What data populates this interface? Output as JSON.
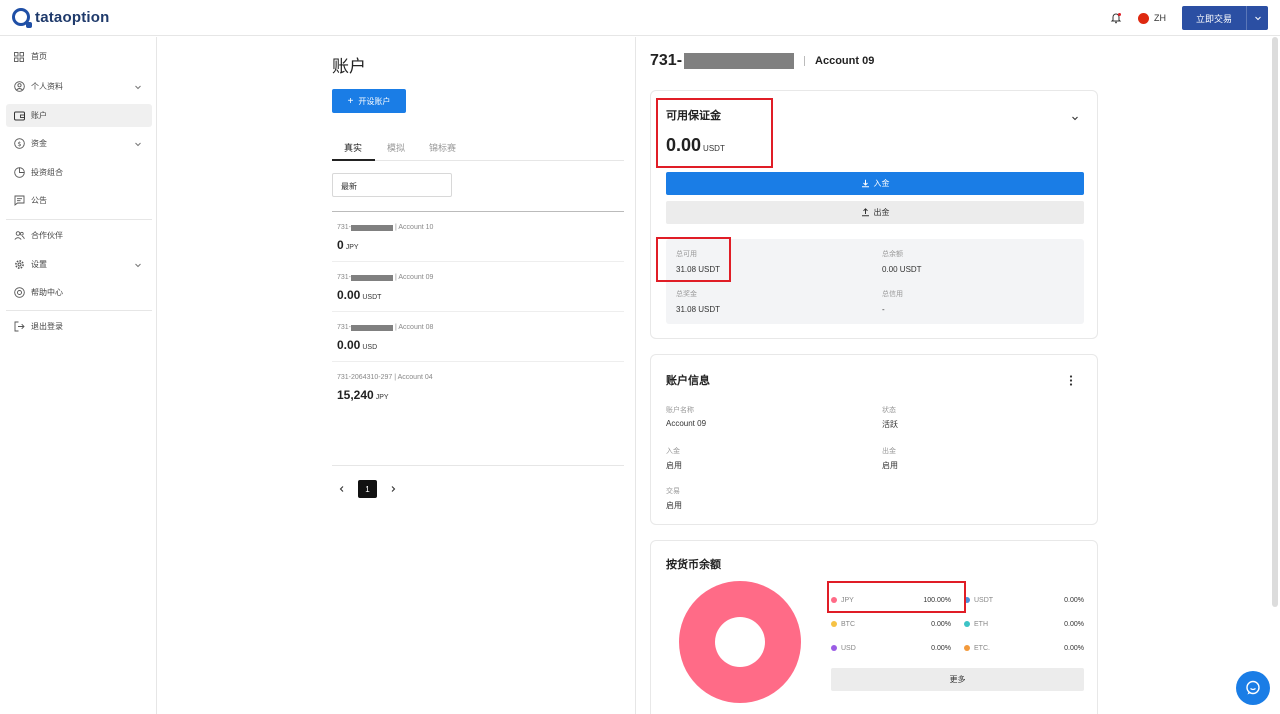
{
  "brand": "tataoption",
  "header": {
    "lang": "ZH",
    "trade_label": "立即交易"
  },
  "sidebar": {
    "items": [
      {
        "label": "首页"
      },
      {
        "label": "个人资料"
      },
      {
        "label": "账户"
      },
      {
        "label": "资金"
      },
      {
        "label": "投资组合"
      },
      {
        "label": "公告"
      },
      {
        "label": "合作伙伴"
      },
      {
        "label": "设置"
      },
      {
        "label": "帮助中心"
      },
      {
        "label": "退出登录"
      }
    ]
  },
  "middle": {
    "title": "账户",
    "open_account_label": "开设账户",
    "tabs": [
      "真实",
      "模拟",
      "锦标赛"
    ],
    "sort_value": "最新",
    "accounts": [
      {
        "prefix": "731-",
        "name": "| Account 10",
        "balance": "0",
        "currency": "JPY"
      },
      {
        "prefix": "731-",
        "name": "| Account 09",
        "balance": "0.00",
        "currency": "USDT"
      },
      {
        "prefix": "731-",
        "name": "| Account 08",
        "balance": "0.00",
        "currency": "USD"
      },
      {
        "prefix": "731-2064310-297",
        "name": "| Account 04",
        "balance": "15,240",
        "currency": "JPY"
      }
    ],
    "page": "1"
  },
  "right": {
    "account_prefix": "731-",
    "account_name": "Account 09",
    "margin": {
      "title": "可用保证金",
      "value": "0.00",
      "currency": "USDT",
      "deposit_label": "入金",
      "withdraw_label": "出金",
      "summary": [
        {
          "label": "总可用",
          "value": "31.08 USDT"
        },
        {
          "label": "总余额",
          "value": "0.00 USDT"
        },
        {
          "label": "总奖金",
          "value": "31.08 USDT"
        },
        {
          "label": "总信用",
          "value": "-"
        }
      ]
    },
    "info": {
      "title": "账户信息",
      "fields": [
        {
          "label": "账户名称",
          "value": "Account 09"
        },
        {
          "label": "状态",
          "value": "活跃"
        },
        {
          "label": "入金",
          "value": "启用"
        },
        {
          "label": "出金",
          "value": "启用"
        },
        {
          "label": "交易",
          "value": "启用"
        }
      ]
    },
    "currency_balance": {
      "title": "按货币余额",
      "legend": [
        {
          "name": "JPY",
          "pct": "100.00%",
          "color": "#ff6b87"
        },
        {
          "name": "USDT",
          "pct": "0.00%",
          "color": "#4a90d9"
        },
        {
          "name": "BTC",
          "pct": "0.00%",
          "color": "#f6c244"
        },
        {
          "name": "ETH",
          "pct": "0.00%",
          "color": "#3cc3c6"
        },
        {
          "name": "USD",
          "pct": "0.00%",
          "color": "#9b5de5"
        },
        {
          "name": "ETC.",
          "pct": "0.00%",
          "color": "#f39a3c"
        }
      ],
      "more_label": "更多"
    }
  },
  "colors": {
    "primary": "#1a7de6",
    "brand_dark": "#2b4fa3",
    "highlight": "#e01d26",
    "donut": "#ff6b87"
  }
}
